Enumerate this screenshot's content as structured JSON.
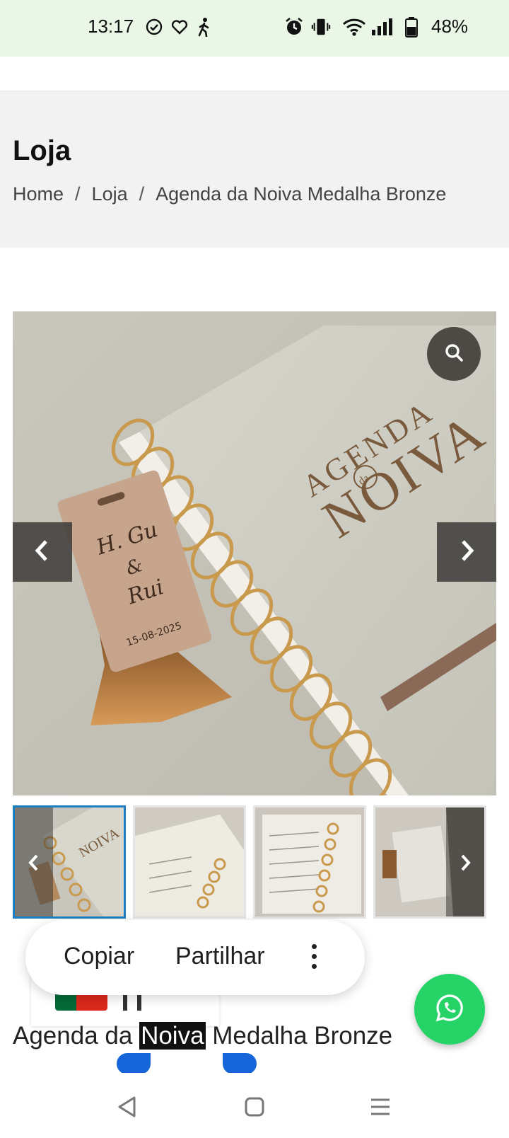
{
  "status_bar": {
    "time": "13:17",
    "battery": "48%",
    "icons": [
      "check-circle-icon",
      "heart-icon",
      "walking-icon",
      "alarm-icon",
      "vibrate-icon",
      "wifi-icon",
      "signal-icon",
      "battery-icon"
    ]
  },
  "header": {
    "title": "Loja",
    "breadcrumb": [
      "Home",
      "Loja",
      "Agenda da Noiva Medalha Bronze"
    ],
    "separator": "/",
    "background": "#f2f2f2"
  },
  "gallery": {
    "thumbnail_count_visible": 4,
    "active_thumbnail": 1,
    "cover_text": {
      "line1": "AGENDA",
      "line2": "da",
      "line3": "NOIVA"
    },
    "tag_text": {
      "names_top": "H. Gu",
      "names_amp": "&",
      "names_bottom": "Rui",
      "date": "15-08-2025"
    },
    "icons": [
      "search-icon",
      "chevron-left-icon",
      "chevron-right-icon"
    ]
  },
  "selection_popup": {
    "copy_label": "Copiar",
    "share_label": "Partilhar",
    "more_icon": "more-vertical-icon"
  },
  "product": {
    "title_before": "Agenda da ",
    "title_selected": "Noiva",
    "title_after": " Medalha Bronze"
  },
  "language": {
    "flag": "portugal-flag-icon"
  },
  "whatsapp": {
    "icon": "whatsapp-icon",
    "color": "#25d366"
  },
  "accent_colors": {
    "selection_handle": "#1565d8",
    "thumbnail_active": "#1c7fc3"
  }
}
